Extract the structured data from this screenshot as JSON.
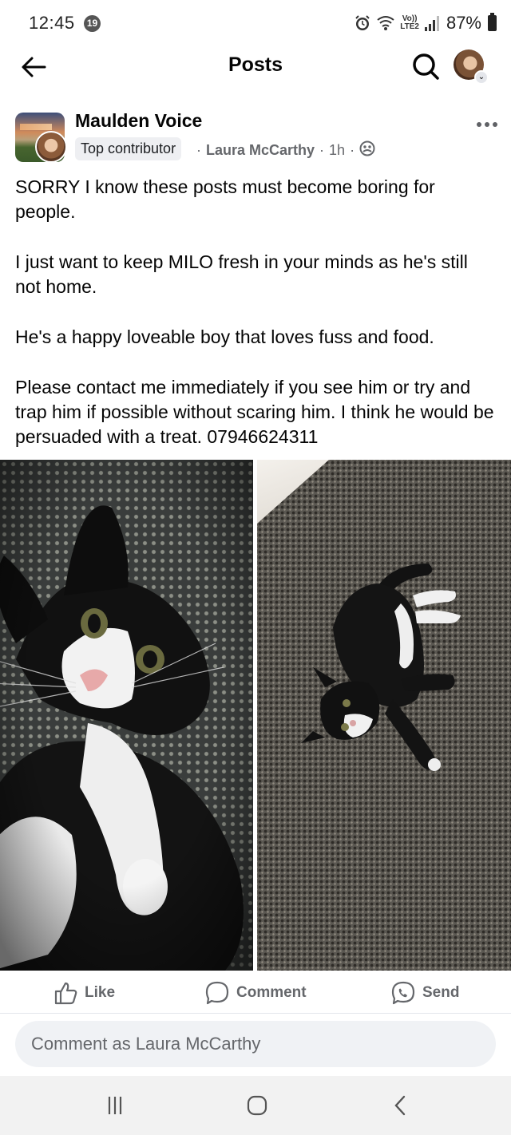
{
  "status_bar": {
    "time": "12:45",
    "notification_count": "19",
    "volte_label": "Vo))\nLTE2",
    "battery": "87%"
  },
  "header": {
    "title": "Posts",
    "back_icon": "arrow-left-icon",
    "search_icon": "search-icon"
  },
  "post": {
    "group_name": "Maulden Voice",
    "badge": "Top contributor",
    "separator": "·",
    "author": "Laura McCarthy",
    "time_ago": "1h",
    "privacy_icon": "group-members-icon",
    "paragraphs": [
      "SORRY I know these posts must become boring for people.",
      "I just want to keep MILO fresh in your minds as he's still not home.",
      "He's a happy loveable boy that loves fuss and food.",
      "Please contact me immediately if you see him or try and trap him if possible without scaring him. I think he would be persuaded with a treat. 07946624311"
    ]
  },
  "actions": {
    "like": "Like",
    "comment": "Comment",
    "send": "Send"
  },
  "comment": {
    "placeholder": "Comment as Laura McCarthy"
  },
  "colors": {
    "secondary_text": "#65676b",
    "input_bg": "#f0f2f5",
    "badge_bg": "#eeeff2"
  }
}
